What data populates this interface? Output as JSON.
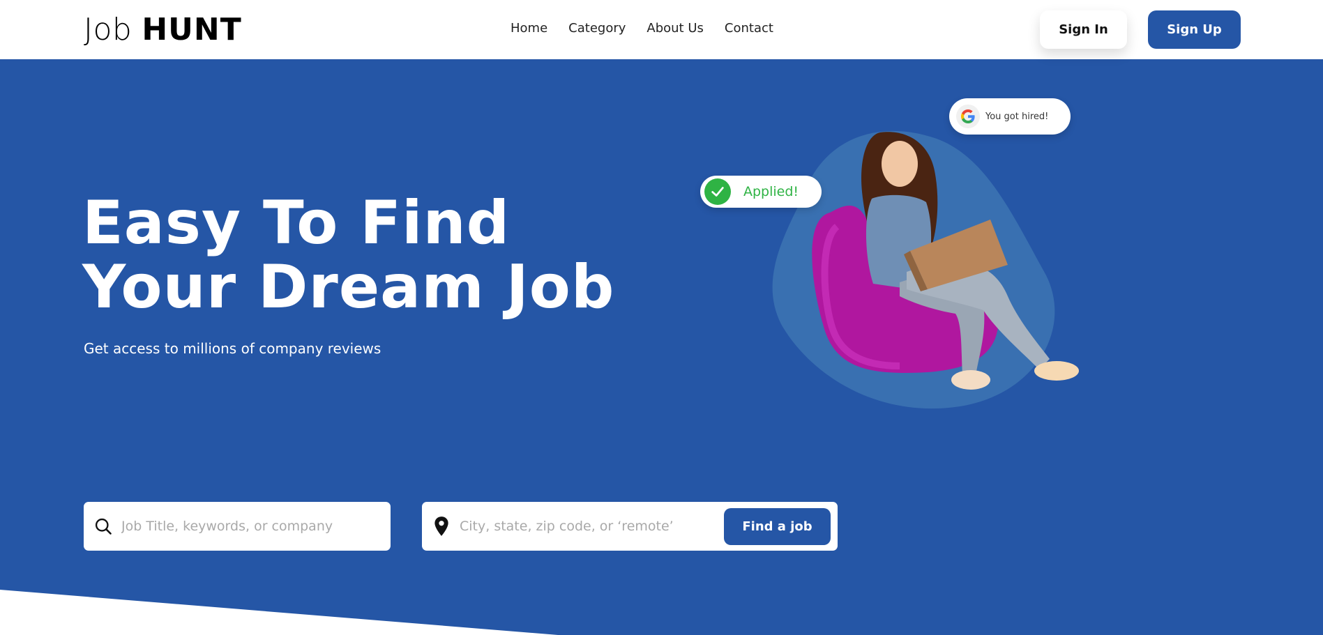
{
  "brand": {
    "name_light": "Job",
    "name_bold": "HUNT"
  },
  "nav": {
    "items": [
      {
        "label": "Home"
      },
      {
        "label": "Category"
      },
      {
        "label": "About Us"
      },
      {
        "label": "Contact"
      }
    ]
  },
  "auth": {
    "sign_in_label": "Sign In",
    "sign_up_label": "Sign Up"
  },
  "hero": {
    "title_line1": "Easy To Find",
    "title_line2": "Your Dream Job",
    "subtitle": "Get access to millions of company reviews"
  },
  "illustration": {
    "applied_badge": "Applied!",
    "hired_badge": "You got hired!"
  },
  "search": {
    "keyword_placeholder": "Job Title, keywords, or company",
    "location_placeholder": "City, state, zip code, or ‘remote’",
    "submit_label": "Find a job"
  },
  "colors": {
    "primary": "#2556a6",
    "success": "#2fb344",
    "background_white": "#ffffff",
    "blob": "#3d74b3",
    "beanbag": "#b0179f"
  },
  "icons": {
    "search": "search-icon",
    "location": "location-pin-icon",
    "check": "check-icon",
    "google": "google-icon"
  }
}
